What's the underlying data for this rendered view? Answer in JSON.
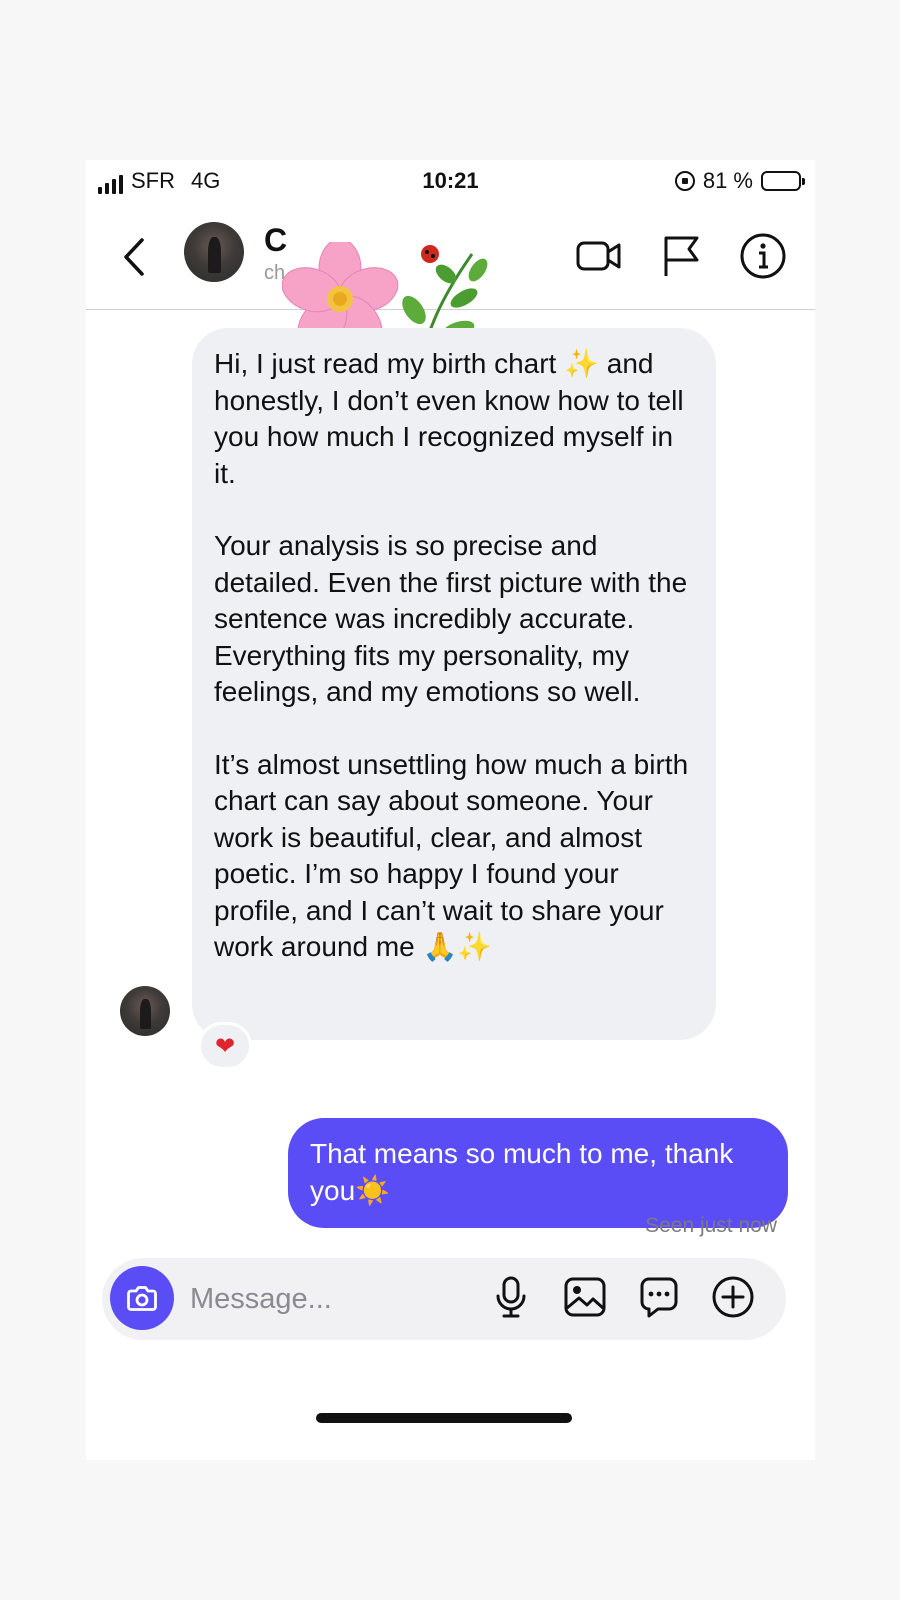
{
  "status_bar": {
    "carrier": "SFR",
    "network": "4G",
    "time": "10:21",
    "battery": "81 %",
    "battery_level": 0.81
  },
  "header": {
    "contact_name": "C",
    "contact_username": "ch",
    "icons": [
      "back-chevron-icon",
      "video-call-icon",
      "flag-icon",
      "info-icon"
    ]
  },
  "messages": [
    {
      "direction": "incoming",
      "paragraphs": [
        "Hi, I just read my birth chart ✨ and honestly, I don’t even know how to tell you how much I recognized myself in it.",
        "Your analysis is so precise and detailed. Even the first picture with the sentence was incredibly accurate. Everything fits my personality, my feelings, and my emotions so well.",
        "It’s almost unsettling how much a birth chart can say about someone. Your work is beautiful, clear, and almost poetic. I’m so happy I found your profile, and I can’t wait to share your work around me 🙏✨"
      ],
      "reaction": "❤"
    },
    {
      "direction": "outgoing",
      "text": "That means so much to me, thank you☀️",
      "status": "Seen just now"
    }
  ],
  "composer": {
    "placeholder": "Message...",
    "icons": [
      "camera-icon",
      "microphone-icon",
      "gallery-icon",
      "sticker-chat-icon",
      "add-icon"
    ]
  },
  "colors": {
    "accent": "#5b4df5",
    "incoming_bubble": "#eef0f4",
    "background": "#ffffff"
  }
}
